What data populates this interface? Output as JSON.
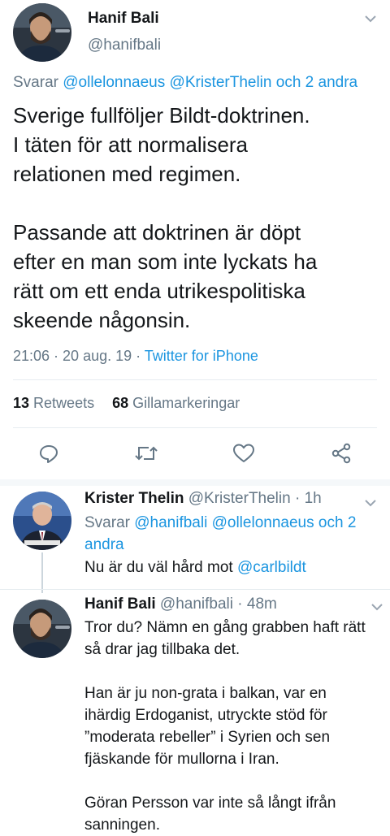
{
  "main_tweet": {
    "author_name": "Hanif Bali",
    "author_handle": "@hanifbali",
    "replying_prefix": "Svarar",
    "replying_to": [
      "@ollelonnaeus",
      "@KristerThelin"
    ],
    "replying_conj": "och",
    "replying_others": "2 andra",
    "paragraph_1": [
      "Sverige fullföljer Bildt-doktrinen.",
      "I täten för att normalisera",
      "relationen med regimen."
    ],
    "paragraph_2": [
      "Passande att doktrinen är döpt",
      "efter en man som inte lyckats ha",
      "rätt om ett enda utrikespolitiska",
      "skeende någonsin."
    ],
    "timestamp": "21:06 · 20 aug. 19 · ",
    "source": "Twitter for iPhone",
    "retweets_count": "13",
    "retweets_label": "Retweets",
    "likes_count": "68",
    "likes_label": "Gillamarkeringar"
  },
  "actions": {
    "icons": [
      "reply-icon",
      "retweet-icon",
      "like-icon",
      "share-icon"
    ]
  },
  "reply_1": {
    "author_name": "Krister Thelin",
    "author_handle": "@KristerThelin",
    "time": "· 1h",
    "replying_prefix": "Svarar",
    "replying_to": [
      "@hanifbali",
      "@ollelonnaeus"
    ],
    "replying_conj": "och",
    "replying_others_line1": "2",
    "replying_others_line2": "andra",
    "text_prefix": "Nu är du väl hård mot ",
    "text_mention": "@carlbildt"
  },
  "reply_2": {
    "author_name": "Hanif Bali",
    "author_handle": "@hanifbali",
    "time": "· 48m",
    "lines_1": [
      "Tror du? Nämn en gång grabben haft rätt",
      "så drar jag tillbaka det."
    ],
    "lines_2": [
      "Han är ju non-grata i balkan, var en",
      "ihärdig Erdoganist, utryckte stöd för",
      "”moderata rebeller” i Syrien och sen",
      "fjäskande för mullorna i Iran."
    ],
    "lines_3": [
      "Göran Persson var inte så långt ifrån",
      "sanningen."
    ]
  },
  "colors": {
    "link": "#1b95e0",
    "secondary": "#657786",
    "divider": "#e6ecf0",
    "text": "#14171a"
  }
}
